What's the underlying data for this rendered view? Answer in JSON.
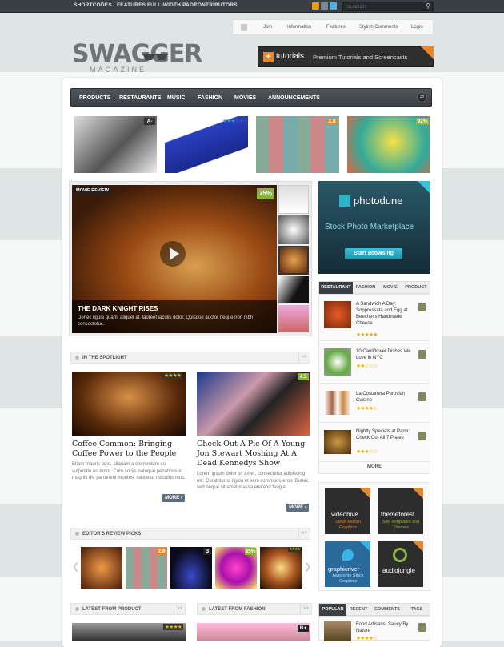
{
  "topbar": {
    "links": [
      "SHORTCODES",
      "FEATURES",
      "FULL-WIDTH PAGE",
      "CONTRIBUTORS"
    ],
    "search_placeholder": "SEARCH"
  },
  "logo": {
    "name": "SWAGGER",
    "sub": "MAGAZINE"
  },
  "topnav": [
    "Join",
    "Information",
    "Features",
    "Stylish Comments",
    "Login"
  ],
  "tutorials_banner": {
    "brand": "tutorials",
    "tagline": "Premium Tutorials and Screencasts"
  },
  "mainnav": [
    "PRODUCTS",
    "RESTAURANTS",
    "MUSIC",
    "FASHION",
    "MOVIES",
    "ANNOUNCEMENTS"
  ],
  "top_tiles": [
    {
      "grade": "A-"
    },
    {
      "grade": ""
    },
    {
      "grade": "2.8"
    },
    {
      "grade": "92%"
    }
  ],
  "feature": {
    "badge": "MOVIE REVIEW",
    "score": "75%",
    "title": "THE DARK KNIGHT RISES",
    "excerpt": "Donec ligula quam, aliquet at, laoreet iaculis dolor. Quisque auctor neque non nibh consectetur.."
  },
  "photodune": {
    "name": "photodune",
    "tagline": "Stock Photo Marketplace",
    "button": "Start Browsing"
  },
  "spotlight": {
    "heading": "IN THE SPOTLIGHT",
    "arrow": ">>",
    "articles": [
      {
        "title": "Coffee Common: Bringing Coffee Power to the People",
        "excerpt": "Etiam mauris odio, aliquam a elementum eu, vulputate eu tortor. Cum sociis natoque penatibus et magnis dis parturient montes, nascetur ridiculus mus.",
        "more": "MORE"
      },
      {
        "title": "Check Out A Pic Of A Young Jon Stewart Moshing At A Dead Kennedys Show",
        "excerpt": "Lorem ipsum dolor sit amet, consectetur adipiscing elit. Curabitur ut ligula et sem commodo eros. Donec sed neque sit amet massa eleifend feugiat.",
        "grade": "4.5",
        "more": "MORE"
      }
    ]
  },
  "sidebar_tabs": {
    "tabs": [
      "RESTAURANT",
      "FASHION",
      "MOVIE",
      "PRODUCT"
    ],
    "items": [
      {
        "title": "A Sandwich A Day: Soppressata and Egg at Beecher's Handmade Cheese"
      },
      {
        "title": "10 Cauliflower Dishes We Love in NYC"
      },
      {
        "title": "La Costanera Peruvian Cuisine"
      },
      {
        "title": "Nightly Specials at Parm: Check Out All 7 Plates"
      }
    ],
    "more": "MORE"
  },
  "ads": [
    {
      "name": "videohive",
      "tagline": "Stock Motion Graphics"
    },
    {
      "name": "themeforest",
      "tagline": "Site Templates and Themes"
    },
    {
      "name": "graphicriver",
      "tagline": "Awesome Stock Graphics"
    },
    {
      "name": "audiojungle",
      "tagline": ""
    }
  ],
  "editors": {
    "heading": "EDITOR'S REVIEW PICKS",
    "arrow": ">>",
    "grades": [
      "",
      "2.8",
      "B",
      "85%",
      ""
    ]
  },
  "latest_product": {
    "heading": "LATEST FROM PRODUCT",
    "arrow": ">>"
  },
  "latest_fashion": {
    "heading": "LATEST FROM FASHION",
    "arrow": ">>",
    "grade": "B+"
  },
  "popular_tabs": {
    "tabs": [
      "POPULAR",
      "RECENT",
      "COMMENTS",
      "TAGS"
    ],
    "item": "Food Artisans: Saucy By Nature"
  },
  "colors": {
    "grade_green": "#8bb33a",
    "grade_orange": "#e8862a",
    "nav_dark": "#3b3f43",
    "more_blue": "#5d6f82",
    "star": "#e8b400"
  }
}
